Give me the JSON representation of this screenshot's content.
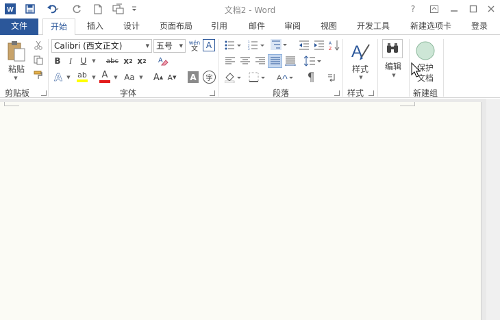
{
  "window": {
    "title": "文档2 - Word",
    "help": "?",
    "ribbon_display_icon": "ribbon-display-icon",
    "minimize_icon": "minimize-icon",
    "restore_icon": "restore-icon",
    "close_icon": "close-icon"
  },
  "quick_access": [
    "word-logo-icon",
    "save-icon",
    "undo-icon",
    "redo-icon",
    "new-document-icon",
    "touch-mode-icon",
    "customize-icon"
  ],
  "tabs": [
    {
      "label": "文件"
    },
    {
      "label": "开始"
    },
    {
      "label": "插入"
    },
    {
      "label": "设计"
    },
    {
      "label": "页面布局"
    },
    {
      "label": "引用"
    },
    {
      "label": "邮件"
    },
    {
      "label": "审阅"
    },
    {
      "label": "视图"
    },
    {
      "label": "开发工具"
    },
    {
      "label": "新建选项卡"
    },
    {
      "label": "登录"
    }
  ],
  "ribbon": {
    "clipboard": {
      "label": "剪贴板",
      "paste_label": "粘贴"
    },
    "font": {
      "label": "字体",
      "font_name": "Calibri (西文正文)",
      "font_size": "五号",
      "phonetic_top": "wén",
      "phonetic_bottom": "文",
      "bold": "B",
      "italic": "I",
      "underline": "U",
      "strike": "abc",
      "subscript_base": "x",
      "subscript_mark": "2",
      "superscript_base": "x",
      "superscript_mark": "2",
      "text_effect": "A",
      "highlight": "ab",
      "font_color": "A",
      "change_case": "Aa",
      "grow": "A",
      "shrink": "A",
      "shading": "A",
      "enclose": "字",
      "border": "A"
    },
    "paragraph": {
      "label": "段落"
    },
    "styles": {
      "label": "样式",
      "button_label": "样式"
    },
    "editing": {
      "button_label": "编辑"
    },
    "new_group": {
      "label": "新建组",
      "protect_line1": "保护",
      "protect_line2": "文档"
    }
  },
  "colors": {
    "accent": "#2b579a",
    "highlight": "#ffff00",
    "font_red": "#e31b1b",
    "protect_circle": "#cde6d6"
  }
}
